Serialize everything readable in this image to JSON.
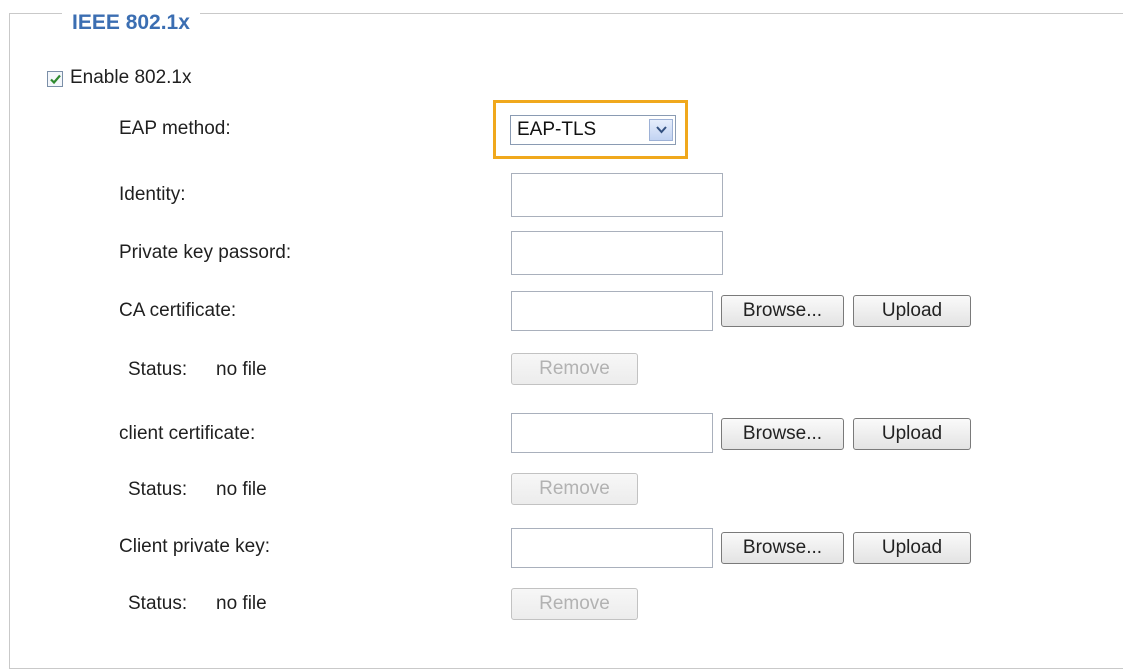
{
  "legend": "IEEE 802.1x",
  "enable": {
    "label": "Enable 802.1x",
    "checked": true
  },
  "eap_method": {
    "label": "EAP method:",
    "value": "EAP-TLS"
  },
  "identity": {
    "label": "Identity:",
    "value": ""
  },
  "private_key_password": {
    "label": "Private key passord:",
    "value": ""
  },
  "ca_certificate": {
    "label": "CA certificate:",
    "browse": "Browse...",
    "upload": "Upload",
    "status_label": "Status:",
    "status_value": "no file",
    "remove": "Remove"
  },
  "client_certificate": {
    "label": "client certificate:",
    "browse": "Browse...",
    "upload": "Upload",
    "status_label": "Status:",
    "status_value": "no file",
    "remove": "Remove"
  },
  "client_private_key": {
    "label": "Client private key:",
    "browse": "Browse...",
    "upload": "Upload",
    "status_label": "Status:",
    "status_value": "no file",
    "remove": "Remove"
  },
  "colors": {
    "legend": "#3b6eb2",
    "highlight": "#f0a81c",
    "border": "#c9c9c9"
  }
}
